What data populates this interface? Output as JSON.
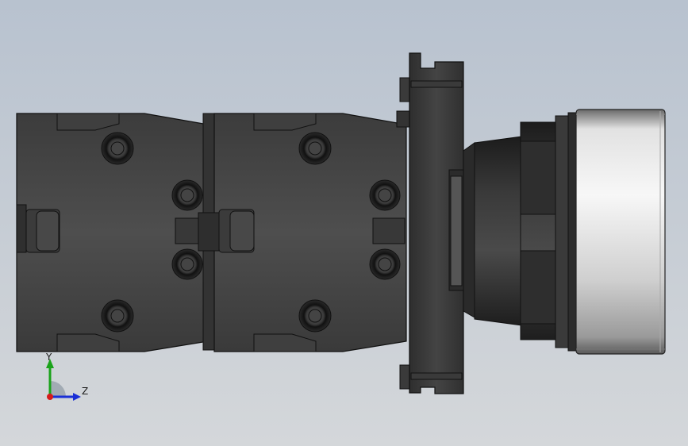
{
  "viewport": {
    "background_top": "#b9c3d0",
    "background_bottom": "#d3d7db"
  },
  "model": {
    "body_color": "#4a4a4a",
    "body_dark": "#2b2b2b",
    "cap_light": "#eeeeee",
    "cap_mid": "#b8b8b8"
  },
  "triad": {
    "y_label": "Y",
    "z_label": "Z",
    "y_color": "#1aa31a",
    "z_color": "#1a2fd6",
    "x_color": "#d61a1a"
  }
}
